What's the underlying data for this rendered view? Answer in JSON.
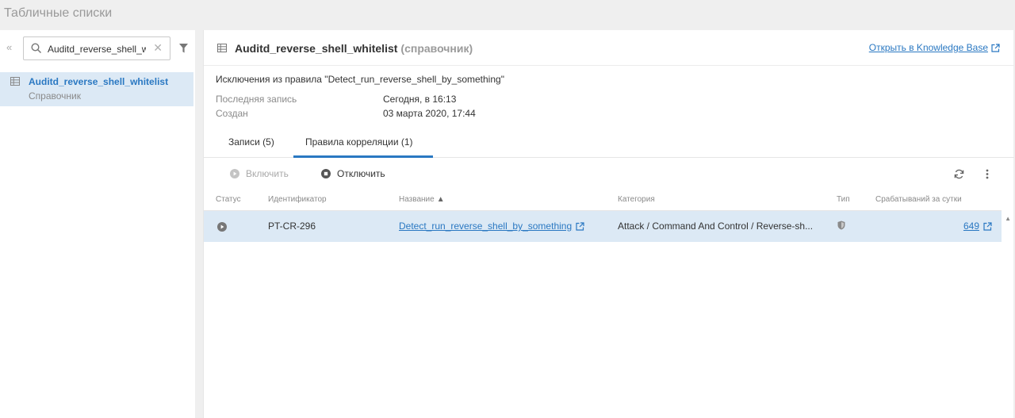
{
  "page": {
    "title": "Табличные списки"
  },
  "sidebar": {
    "collapse_glyph": "«",
    "search": {
      "value": "Auditd_reverse_shell_whitelist",
      "clear_glyph": "✕"
    },
    "items": [
      {
        "title": "Auditd_reverse_shell_whitelist",
        "subtitle": "Справочник"
      }
    ]
  },
  "detail": {
    "name": "Auditd_reverse_shell_whitelist",
    "kind": "(справочник)",
    "kb_link": "Открыть в Knowledge Base",
    "description": "Исключения из правила \"Detect_run_reverse_shell_by_something\"",
    "meta": [
      {
        "label": "Последняя запись",
        "value": "Сегодня, в 16:13"
      },
      {
        "label": "Создан",
        "value": "03 марта 2020, 17:44"
      }
    ],
    "tabs": [
      {
        "label": "Записи (5)",
        "active": false
      },
      {
        "label": "Правила корреляции (1)",
        "active": true
      }
    ],
    "toolbar": {
      "enable_label": "Включить",
      "disable_label": "Отключить"
    },
    "columns": {
      "status": "Статус",
      "id": "Идентификатор",
      "name": "Название",
      "sort_glyph": "▲",
      "category": "Категория",
      "type": "Тип",
      "hits": "Срабатываний за сутки"
    },
    "rows": [
      {
        "id": "PT-CR-296",
        "name": "Detect_run_reverse_shell_by_something",
        "category": "Attack / Command And Control / Reverse-sh...",
        "hits": "649"
      }
    ]
  },
  "colors": {
    "accent": "#2a78c2",
    "selection": "#dce9f5",
    "background": "#efefef"
  }
}
